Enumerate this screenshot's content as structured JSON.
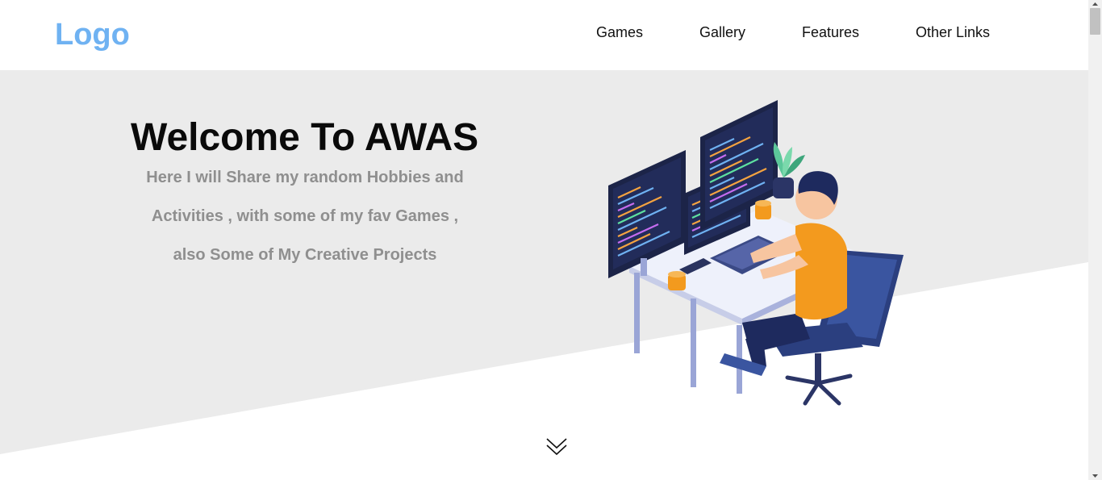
{
  "header": {
    "logo": "Logo",
    "nav": [
      "Games",
      "Gallery",
      "Features",
      "Other Links"
    ]
  },
  "hero": {
    "title": "Welcome To AWAS",
    "lines": [
      "Here I will Share my random Hobbies and",
      "Activities , with some of my fav Games ,",
      "also Some of My Creative Projects"
    ]
  },
  "colors": {
    "logo": "#6fb2f2",
    "hero_background": "#ebebeb",
    "accent_orange": "#f39a1e",
    "title": "#0a0a0a",
    "subtitle": "#8f8f8f"
  },
  "icons": {
    "scroll_down": "double-chevron-down-icon"
  }
}
